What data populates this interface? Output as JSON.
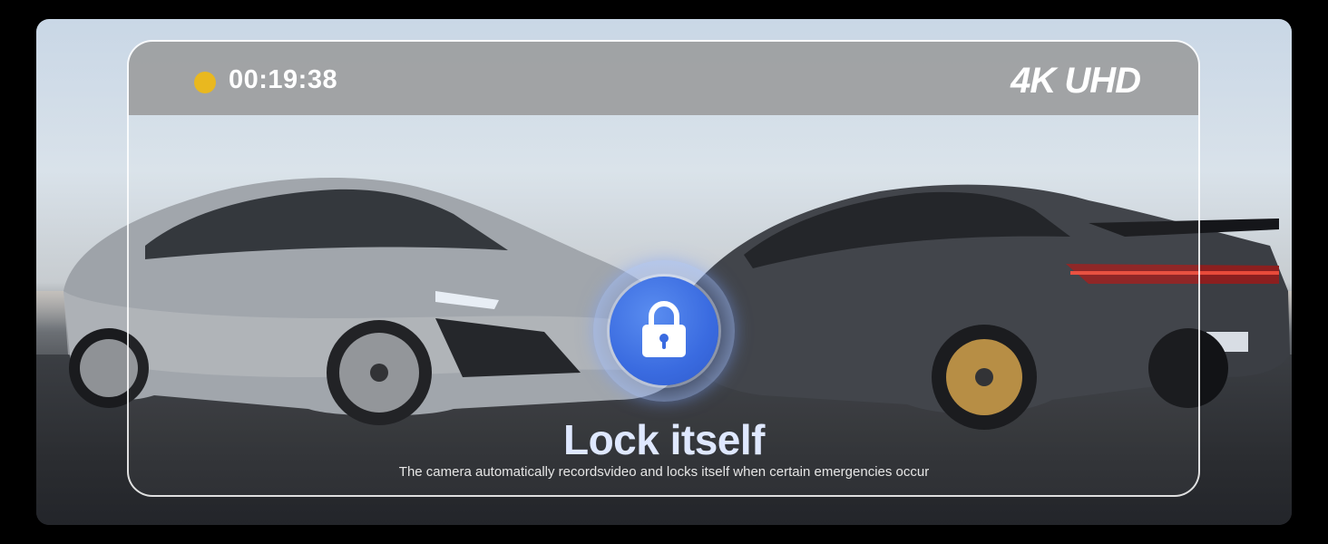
{
  "recording": {
    "status_color": "#e9b81f",
    "timer": "00:19:38",
    "resolution": "4K UHD"
  },
  "feature": {
    "icon": "lock-icon",
    "title": "Lock itself",
    "description": "The camera automatically recordsvideo and locks itself when certain emergencies occur",
    "accent_color": "#3a6be0"
  }
}
